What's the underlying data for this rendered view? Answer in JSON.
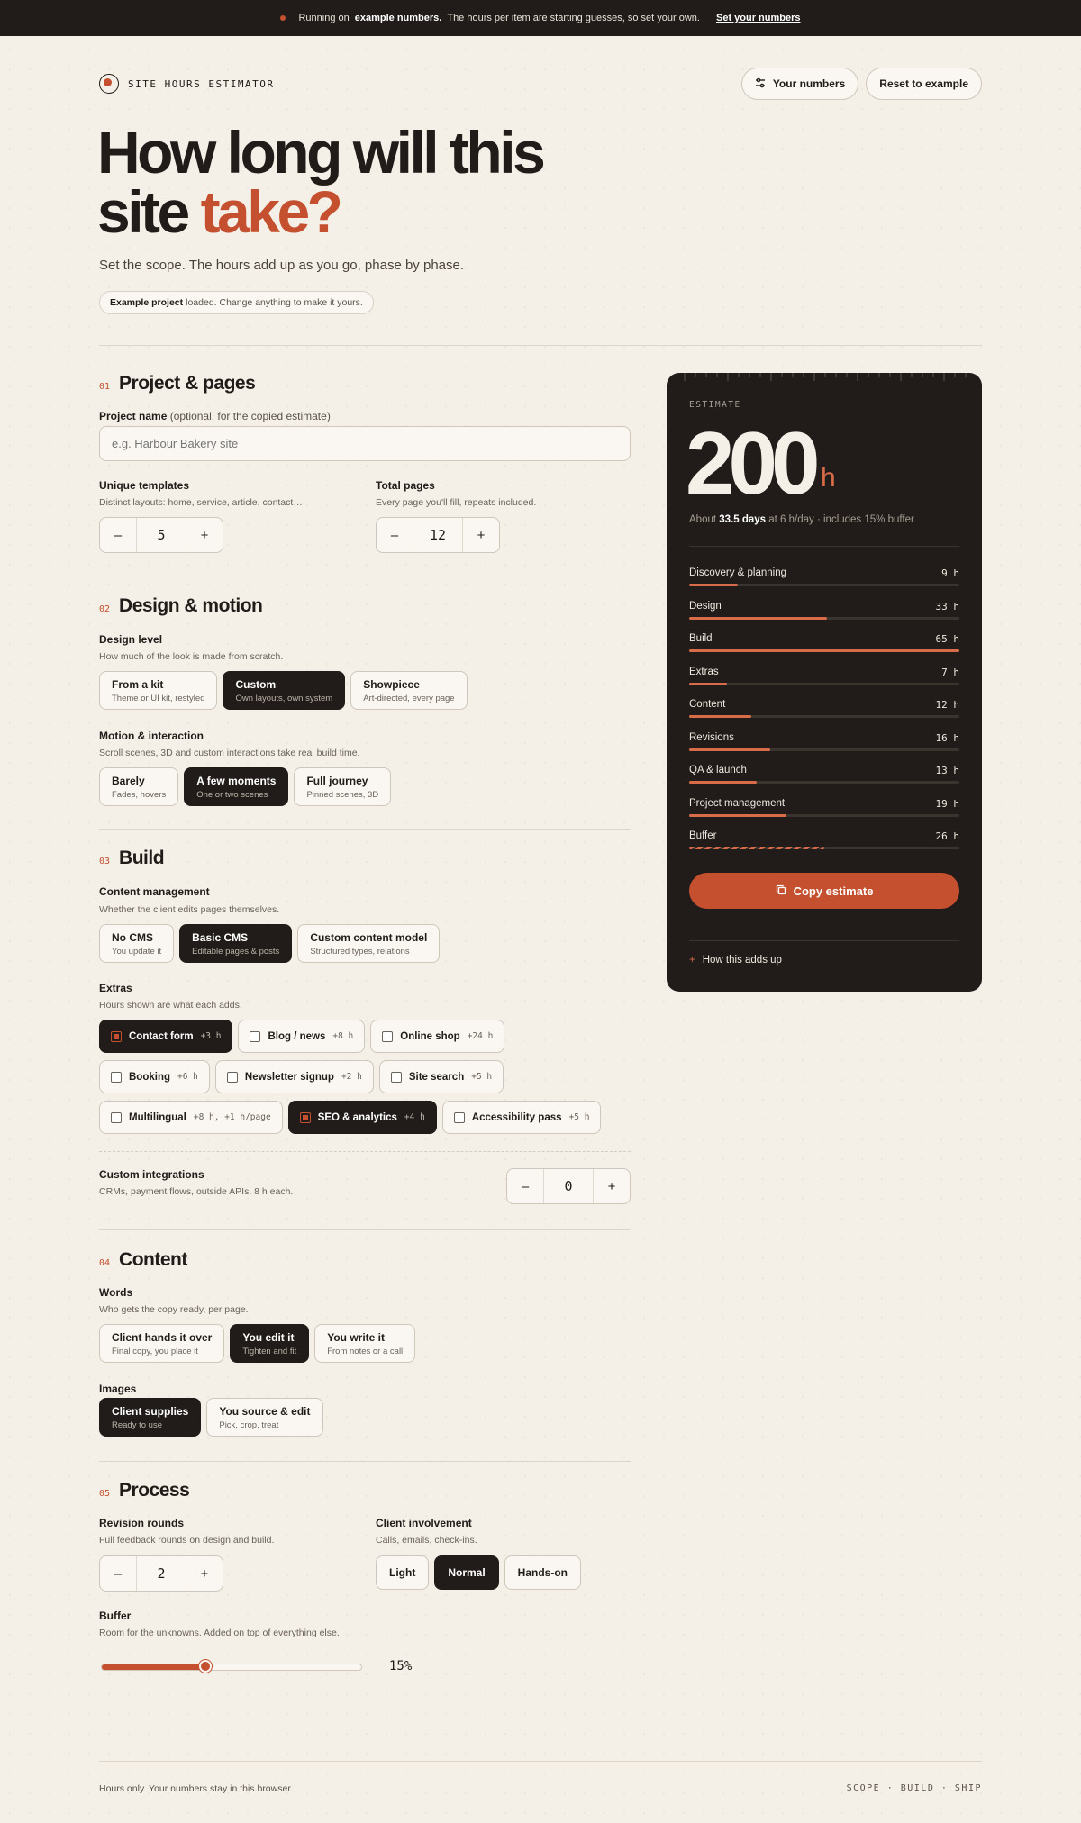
{
  "topbar": {
    "pre": "Running on",
    "bold": "example numbers.",
    "post": "The hours per item are starting guesses, so set your own.",
    "link": "Set your numbers"
  },
  "header": {
    "brand": "SITE HOURS ESTIMATOR",
    "your_numbers": "Your numbers",
    "reset": "Reset to example"
  },
  "hero": {
    "title_line1": "How long will this",
    "title_line2_a": "site",
    "title_line2_b": "take?",
    "subtitle": "Set the scope. The hours add up as you go, phase by phase.",
    "loaded_bold": "Example project",
    "loaded_text": "loaded. Change anything to make it yours."
  },
  "sections": {
    "s1": {
      "num": "01",
      "title": "Project & pages"
    },
    "s2": {
      "num": "02",
      "title": "Design & motion"
    },
    "s3": {
      "num": "03",
      "title": "Build"
    },
    "s4": {
      "num": "04",
      "title": "Content"
    },
    "s5": {
      "num": "05",
      "title": "Process"
    }
  },
  "project": {
    "name_label": "Project name",
    "name_hint": "(optional, for the copied estimate)",
    "name_placeholder": "e.g. Harbour Bakery site",
    "templates_label": "Unique templates",
    "templates_desc": "Distinct layouts: home, service, article, contact…",
    "templates_value": "5",
    "pages_label": "Total pages",
    "pages_desc": "Every page you'll fill, repeats included.",
    "pages_value": "12"
  },
  "design": {
    "level_label": "Design level",
    "level_desc": "How much of the look is made from scratch.",
    "level_options": [
      {
        "title": "From a kit",
        "sub": "Theme or UI kit, restyled"
      },
      {
        "title": "Custom",
        "sub": "Own layouts, own system"
      },
      {
        "title": "Showpiece",
        "sub": "Art-directed, every page"
      }
    ],
    "motion_label": "Motion & interaction",
    "motion_desc": "Scroll scenes, 3D and custom interactions take real build time.",
    "motion_options": [
      {
        "title": "Barely",
        "sub": "Fades, hovers"
      },
      {
        "title": "A few moments",
        "sub": "One or two scenes"
      },
      {
        "title": "Full journey",
        "sub": "Pinned scenes, 3D"
      }
    ]
  },
  "build": {
    "cms_label": "Content management",
    "cms_desc": "Whether the client edits pages themselves.",
    "cms_options": [
      {
        "title": "No CMS",
        "sub": "You update it"
      },
      {
        "title": "Basic CMS",
        "sub": "Editable pages & posts"
      },
      {
        "title": "Custom content model",
        "sub": "Structured types, relations"
      }
    ],
    "extras_label": "Extras",
    "extras_desc": "Hours shown are what each adds.",
    "extras": [
      {
        "name": "Contact form",
        "hours": "+3 h"
      },
      {
        "name": "Blog / news",
        "hours": "+8 h"
      },
      {
        "name": "Online shop",
        "hours": "+24 h"
      },
      {
        "name": "Booking",
        "hours": "+6 h"
      },
      {
        "name": "Newsletter signup",
        "hours": "+2 h"
      },
      {
        "name": "Site search",
        "hours": "+5 h"
      },
      {
        "name": "Multilingual",
        "hours": "+8 h, +1 h/page"
      },
      {
        "name": "SEO & analytics",
        "hours": "+4 h"
      },
      {
        "name": "Accessibility pass",
        "hours": "+5 h"
      }
    ],
    "integrations_label": "Custom integrations",
    "integrations_desc": "CRMs, payment flows, outside APIs. 8 h each.",
    "integrations_value": "0"
  },
  "content": {
    "words_label": "Words",
    "words_desc": "Who gets the copy ready, per page.",
    "words_options": [
      {
        "title": "Client hands it over",
        "sub": "Final copy, you place it"
      },
      {
        "title": "You edit it",
        "sub": "Tighten and fit"
      },
      {
        "title": "You write it",
        "sub": "From notes or a call"
      }
    ],
    "images_label": "Images",
    "images_options": [
      {
        "title": "Client supplies",
        "sub": "Ready to use"
      },
      {
        "title": "You source & edit",
        "sub": "Pick, crop, treat"
      }
    ]
  },
  "process": {
    "revisions_label": "Revision rounds",
    "revisions_desc": "Full feedback rounds on design and build.",
    "revisions_value": "2",
    "involvement_label": "Client involvement",
    "involvement_desc": "Calls, emails, check-ins.",
    "involvement_options": [
      "Light",
      "Normal",
      "Hands-on"
    ],
    "buffer_label": "Buffer",
    "buffer_desc": "Room for the unknowns. Added on top of everything else.",
    "buffer_fraction": 0.4,
    "buffer_value": "15%"
  },
  "estimate": {
    "label": "ESTIMATE",
    "total": "200",
    "unit": "h",
    "about_pre": "About",
    "about_days": "33.5 days",
    "about_post": "at 6 h/day · includes 15% buffer",
    "phases": [
      {
        "name": "Discovery & planning",
        "hours": "9 h",
        "fraction": 0.18
      },
      {
        "name": "Design",
        "hours": "33 h",
        "fraction": 0.51
      },
      {
        "name": "Build",
        "hours": "65 h",
        "fraction": 1.0
      },
      {
        "name": "Extras",
        "hours": "7 h",
        "fraction": 0.14
      },
      {
        "name": "Content",
        "hours": "12 h",
        "fraction": 0.23
      },
      {
        "name": "Revisions",
        "hours": "16 h",
        "fraction": 0.3
      },
      {
        "name": "QA & launch",
        "hours": "13 h",
        "fraction": 0.25
      },
      {
        "name": "Project management",
        "hours": "19 h",
        "fraction": 0.36
      },
      {
        "name": "Buffer",
        "hours": "26 h",
        "fraction": 0.5
      }
    ],
    "copy_label": "Copy estimate",
    "how_label": "How this adds up"
  },
  "footer": {
    "left": "Hours only. Your numbers stay in this browser.",
    "right": "SCOPE · BUILD · SHIP"
  },
  "colors": {
    "accent": "#c4502f",
    "dark": "#211c19",
    "background": "#f4efe7"
  }
}
